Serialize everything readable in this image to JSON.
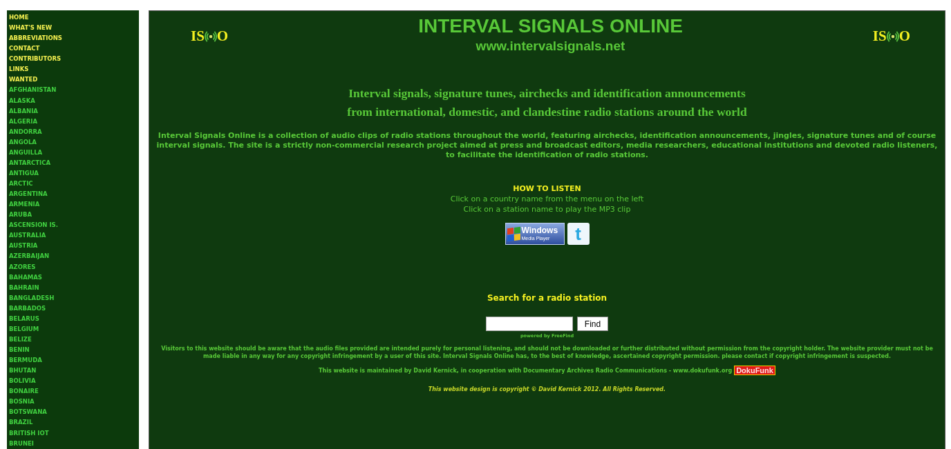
{
  "sidebar": {
    "menu": [
      "HOME",
      "WHAT'S NEW",
      "ABBREVIATIONS",
      "CONTACT",
      "CONTRIBUTORS",
      "LINKS",
      "WANTED"
    ],
    "countries": [
      "AFGHANISTAN",
      "ALASKA",
      "ALBANIA",
      "ALGERIA",
      "ANDORRA",
      "ANGOLA",
      "ANGUILLA",
      "ANTARCTICA",
      "ANTIGUA",
      "ARCTIC",
      "ARGENTINA",
      "ARMENIA",
      "ARUBA",
      "ASCENSION IS.",
      "AUSTRALIA",
      "AUSTRIA",
      "AZERBAIJAN",
      "AZORES",
      "BAHAMAS",
      "BAHRAIN",
      "BANGLADESH",
      "BARBADOS",
      "BELARUS",
      "BELGIUM",
      "BELIZE",
      "BENIN",
      "BERMUDA",
      "BHUTAN",
      "BOLIVIA",
      "BONAIRE",
      "BOSNIA",
      "BOTSWANA",
      "BRAZIL",
      "BRITISH IOT",
      "BRUNEI"
    ]
  },
  "header": {
    "logos": [
      {
        "left_text": "IS",
        "right_text": "O"
      },
      {
        "left_text": "IS",
        "right_text": "O"
      }
    ],
    "title": "INTERVAL SIGNALS ONLINE",
    "url": "www.intervalsignals.net"
  },
  "tagline": [
    "Interval signals, signature tunes, airchecks and identification announcements",
    "from international, domestic, and clandestine radio stations around the world"
  ],
  "intro": "Interval Signals Online is a collection of audio clips of radio stations throughout the world, featuring airchecks, identification announcements, jingles, signature tunes and of course interval signals. The site is a strictly non-commercial research project aimed at press and broadcast editors, media researchers, educational institutions and devoted radio listeners, to facilitate the identification of radio stations.",
  "how_to_listen": {
    "heading": "HOW TO LISTEN",
    "lines": [
      "Click on a country name from the menu on the left",
      "Click on a station name to play the MP3 clip"
    ]
  },
  "badges": {
    "media_player": [
      "Windows",
      "Media Player"
    ],
    "twitter": "t"
  },
  "search": {
    "heading": "Search for a radio station",
    "button": "Find",
    "powered_by": "powered by FreeFind"
  },
  "disclaimer": "Visitors to this website should be aware that the audio files provided are intended purely for personal listening, and should not be downloaded or further distributed without permission from the copyright holder. The website provider must not be made liable in any way for any copyright infringement by a user of this site. Interval Signals Online has, to the best of knowledge, ascertained copyright permission. please contact if copyright infringement is suspected.",
  "maintained": {
    "text": "This website is maintained by David Kernick, in cooperation with Documentary Archives Radio Communications - www.dokufunk.org",
    "badge": "DokuFunk"
  },
  "copyright": "This website design is copyright © David Kernick 2012. All Rights Reserved."
}
